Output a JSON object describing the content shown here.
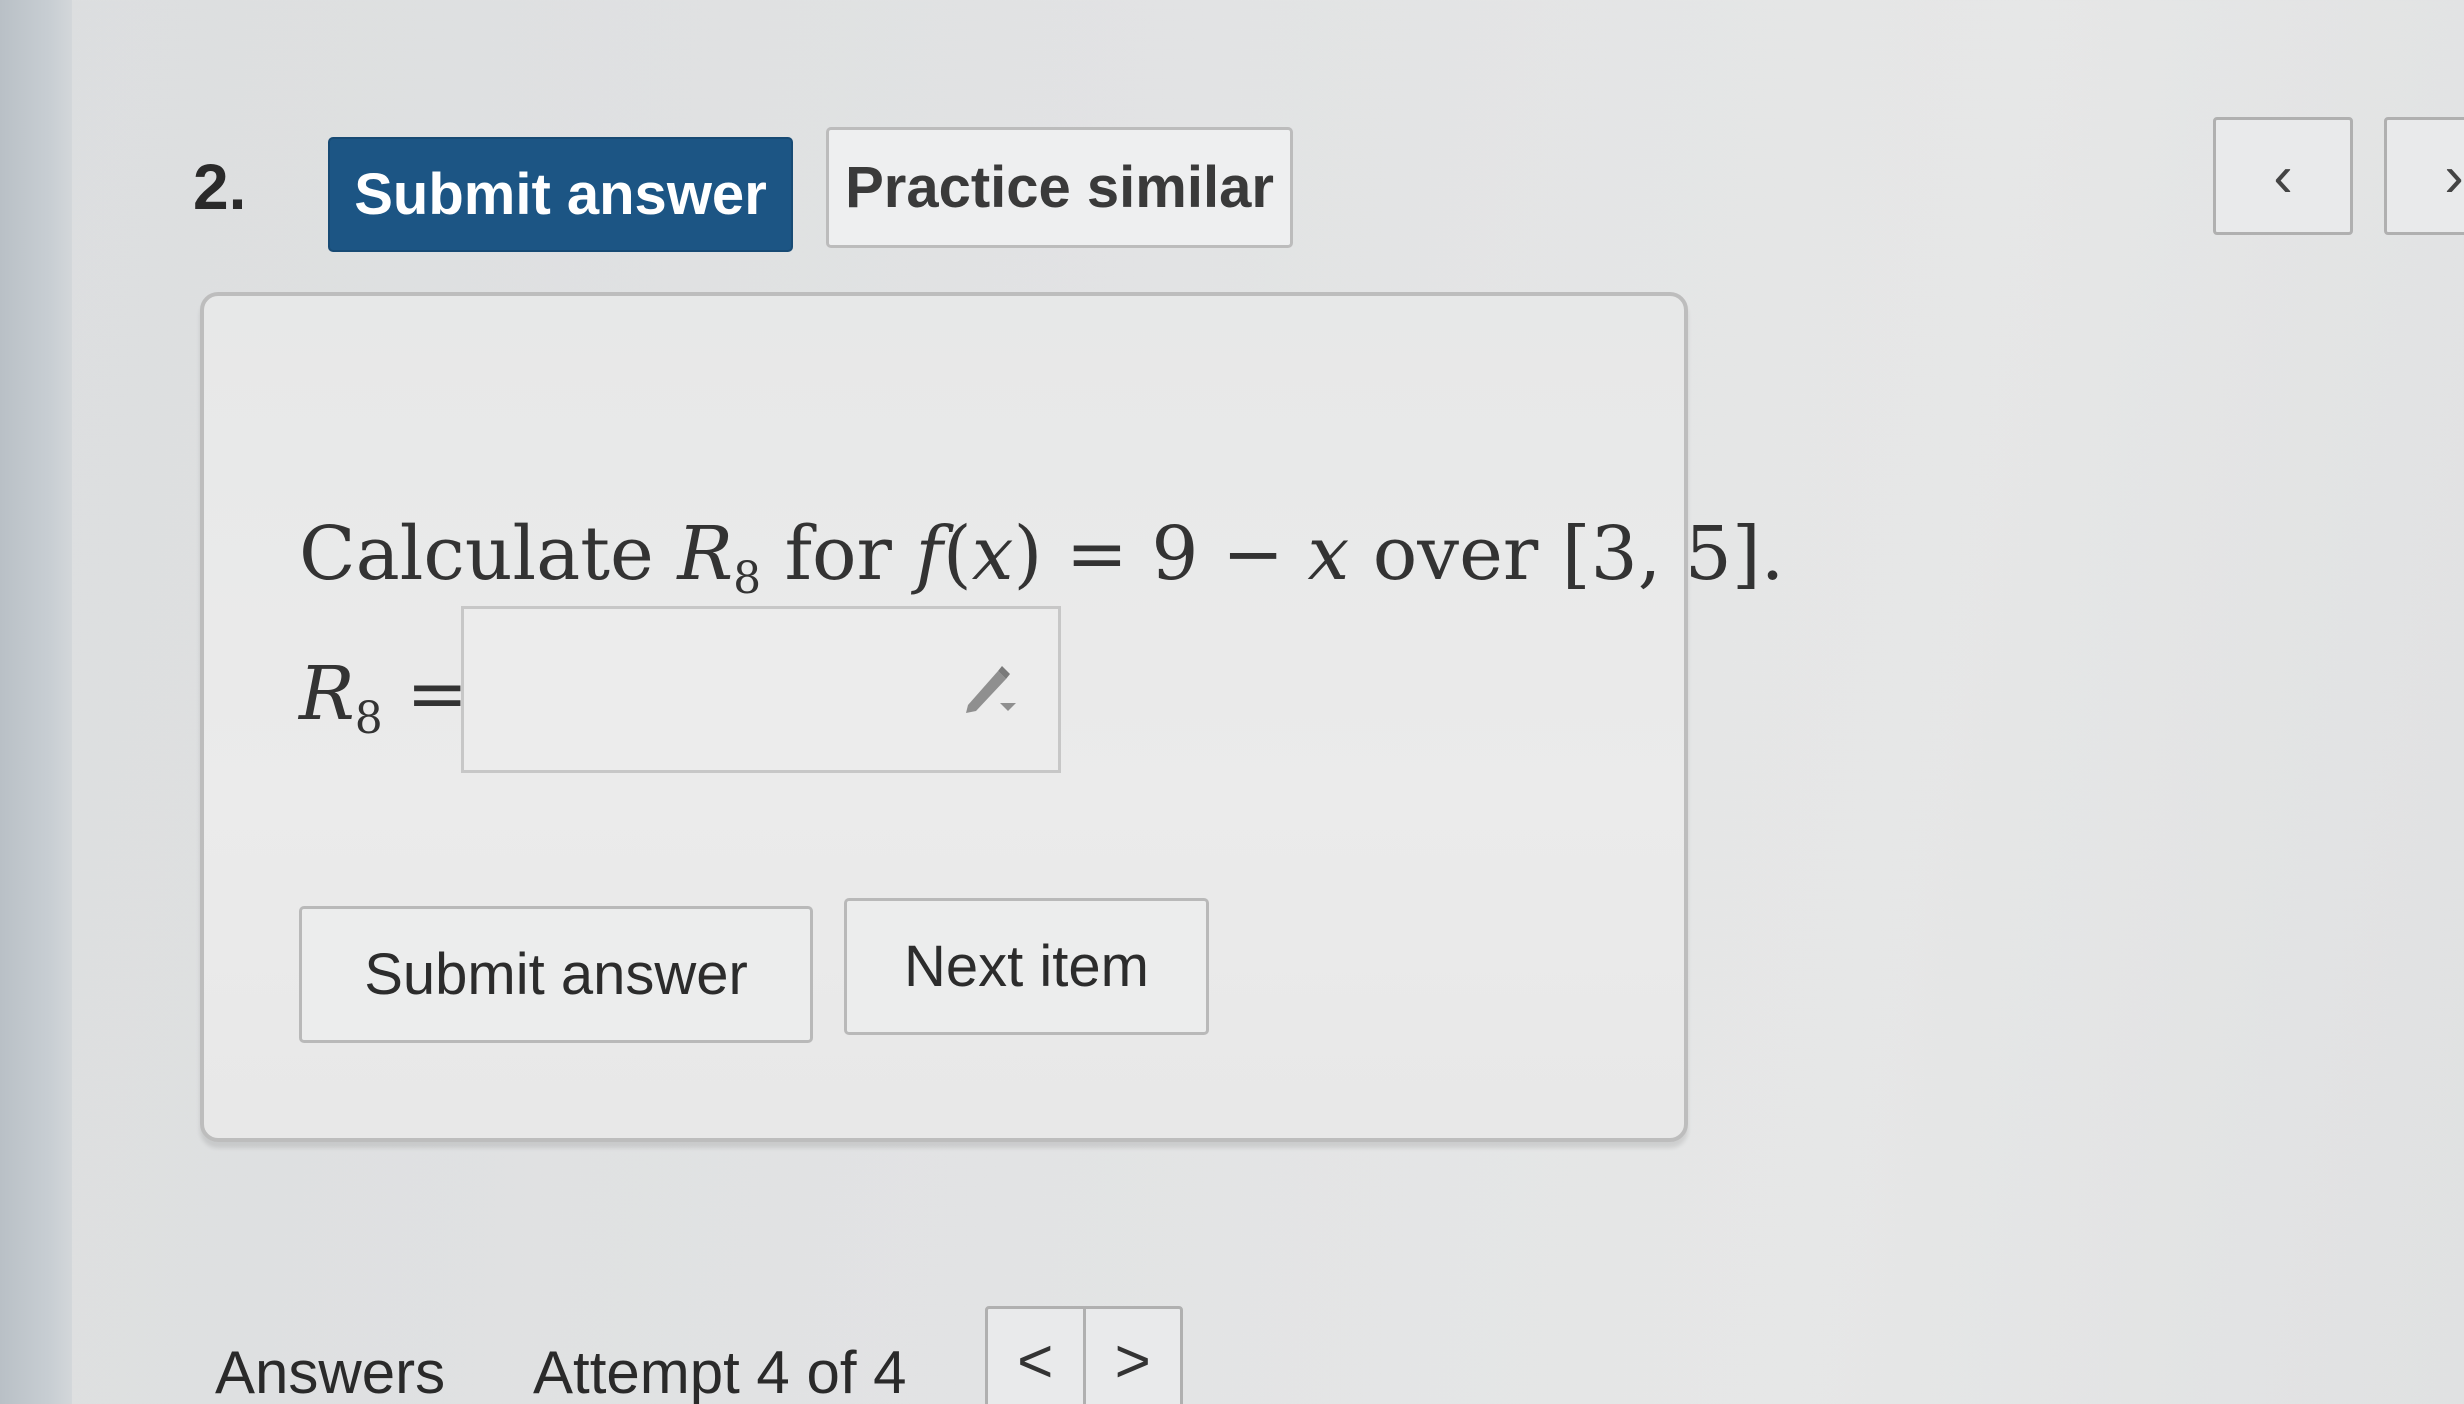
{
  "question": {
    "number": "2."
  },
  "toolbar": {
    "submit_label": "Submit answer",
    "practice_label": "Practice similar",
    "prev_icon": "‹",
    "next_icon": "›"
  },
  "card": {
    "prompt_prefix": "Calculate ",
    "prompt_var": "R",
    "prompt_sub": "8",
    "prompt_for": " for ",
    "prompt_func": "f",
    "prompt_open": "(",
    "prompt_x": "x",
    "prompt_close_eq": ") = 9 − ",
    "prompt_x2": "x",
    "prompt_over": " over [3, 5].",
    "answer_var": "R",
    "answer_sub": "8",
    "answer_eq": " =",
    "answer_value": "",
    "submit_label": "Submit answer",
    "next_label": "Next item"
  },
  "footer": {
    "answers_label": "Answers",
    "attempt_label": "Attempt 4 of 4",
    "prev_icon": "<",
    "next_icon": ">"
  },
  "colors": {
    "primary": "#1c5584",
    "border": "#bdbdbd"
  }
}
